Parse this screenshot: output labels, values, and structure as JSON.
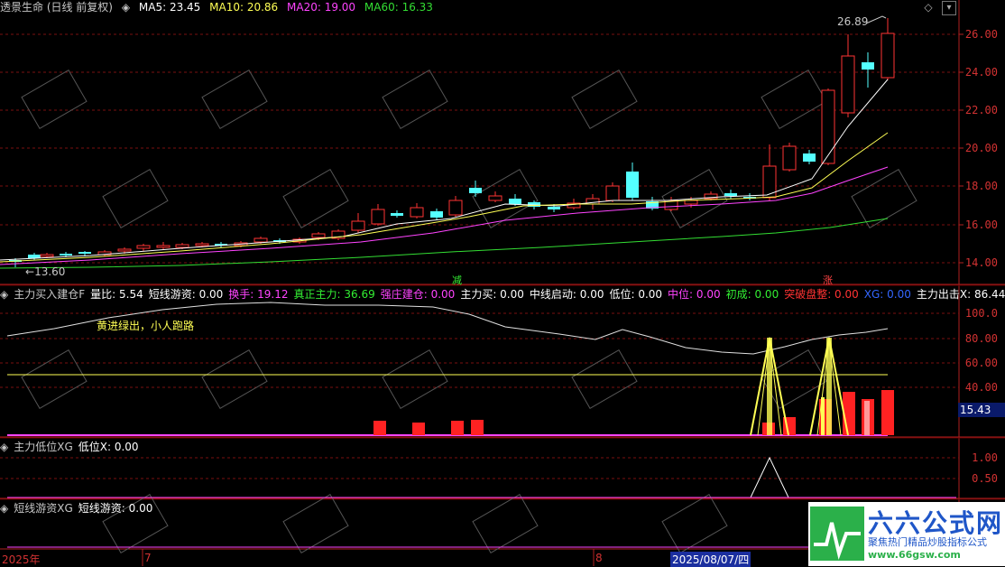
{
  "header": {
    "title": "透景生命 (日线 前复权)",
    "ma5": "MA5: 23.45",
    "ma10": "MA10: 20.86",
    "ma20": "MA20: 19.00",
    "ma60": "MA60: 16.33",
    "colors": {
      "ma5": "#ffffff",
      "ma10": "#ffff55",
      "ma20": "#ff44ff",
      "ma60": "#33dd33"
    }
  },
  "price_axis": [
    "26.00",
    "24.00",
    "22.00",
    "20.00",
    "18.00",
    "16.00",
    "14.00"
  ],
  "price_high_label": "26.89",
  "price_low_label": "13.60",
  "markers": {
    "jian": "减",
    "zhang": "涨"
  },
  "panel2": {
    "header": [
      {
        "t": "主力买入建仓F",
        "c": "#c8c8c8"
      },
      {
        "t": "量比: 5.54",
        "c": "#ffffff"
      },
      {
        "t": "短线游资: 0.00",
        "c": "#ffffff"
      },
      {
        "t": "换手: 19.12",
        "c": "#ff44ff"
      },
      {
        "t": "真正主力: 36.69",
        "c": "#33ee33"
      },
      {
        "t": "强庄建仓: 0.00",
        "c": "#ff44ff"
      },
      {
        "t": "主力买: 0.00",
        "c": "#ffffff"
      },
      {
        "t": "中线启动: 0.00",
        "c": "#ffffff"
      },
      {
        "t": "低位: 0.00",
        "c": "#ffffff"
      },
      {
        "t": "中位: 0.00",
        "c": "#ff44ff"
      },
      {
        "t": "初成: 0.00",
        "c": "#33ee33"
      },
      {
        "t": "突破盘整: 0.00",
        "c": "#ff3333"
      },
      {
        "t": "XG: 0.00",
        "c": "#3366ff"
      },
      {
        "t": "主力出击X: 86.44",
        "c": "#ffffff"
      },
      {
        "t": ": 50",
        "c": "#ffffff"
      }
    ],
    "note": "黄进绿出，小人跑路",
    "axis": [
      "100.0",
      "80.00",
      "60.00",
      "40.00"
    ],
    "current_value": "15.43"
  },
  "panel3": {
    "header": [
      {
        "t": "主力低位XG",
        "c": "#c8c8c8"
      },
      {
        "t": "低位X: 0.00",
        "c": "#ffffff"
      }
    ],
    "axis": [
      "1.00",
      "0.50"
    ]
  },
  "panel4": {
    "header": [
      {
        "t": "短线游资XG",
        "c": "#c8c8c8"
      },
      {
        "t": "短线游资: 0.00",
        "c": "#ffffff"
      }
    ],
    "axis": [
      "1.00"
    ]
  },
  "footer": {
    "year": "2025年",
    "m7": "7",
    "m8": "8",
    "date": "2025/08/07/四",
    "period": "日线"
  },
  "logo": {
    "title": "六六公式网",
    "subtitle": "聚焦热门精品炒股指标公式",
    "url": "www.66gsw.com"
  },
  "watermark": "六六公式网"
}
